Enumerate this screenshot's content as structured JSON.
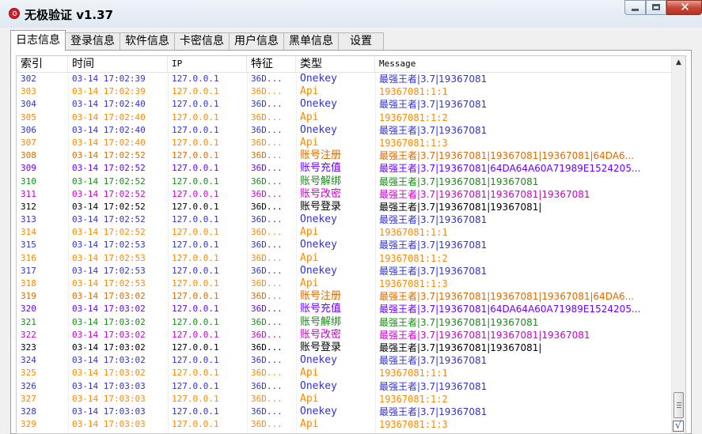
{
  "window": {
    "title": "无极验证 v1.37",
    "icon": "app-logo-icon",
    "buttons": {
      "minimize": "minimize-icon",
      "maximize": "maximize-icon",
      "close": "✕"
    }
  },
  "tabs": [
    {
      "label": "日志信息",
      "active": true
    },
    {
      "label": "登录信息"
    },
    {
      "label": "软件信息"
    },
    {
      "label": "卡密信息"
    },
    {
      "label": "用户信息"
    },
    {
      "label": "黑单信息"
    },
    {
      "label": "设置"
    }
  ],
  "colors": {
    "onekey": "#3333cc",
    "api": "#ff8800",
    "register": "#e06a00",
    "recharge": "#6a00ff",
    "unbind": "#1a8a1a",
    "modify": "#cc00cc",
    "login": "#000000"
  },
  "log_table": {
    "headers": [
      "索引",
      "时间",
      "IP",
      "特征",
      "类型",
      "Message"
    ],
    "rows": [
      {
        "idx": "302",
        "time": "03-14 17:02:39",
        "ip": "127.0.0.1",
        "feat": "36D...",
        "type": "Onekey",
        "msg": "最强王者|3.7|19367081",
        "kind": "onekey"
      },
      {
        "idx": "303",
        "time": "03-14 17:02:39",
        "ip": "127.0.0.1",
        "feat": "36D...",
        "type": "Api",
        "msg": "19367081:1:1",
        "kind": "api"
      },
      {
        "idx": "304",
        "time": "03-14 17:02:40",
        "ip": "127.0.0.1",
        "feat": "36D...",
        "type": "Onekey",
        "msg": "最强王者|3.7|19367081",
        "kind": "onekey"
      },
      {
        "idx": "305",
        "time": "03-14 17:02:40",
        "ip": "127.0.0.1",
        "feat": "36D...",
        "type": "Api",
        "msg": "19367081:1:2",
        "kind": "api"
      },
      {
        "idx": "306",
        "time": "03-14 17:02:40",
        "ip": "127.0.0.1",
        "feat": "36D...",
        "type": "Onekey",
        "msg": "最强王者|3.7|19367081",
        "kind": "onekey"
      },
      {
        "idx": "307",
        "time": "03-14 17:02:40",
        "ip": "127.0.0.1",
        "feat": "36D...",
        "type": "Api",
        "msg": "19367081:1:3",
        "kind": "api"
      },
      {
        "idx": "308",
        "time": "03-14 17:02:52",
        "ip": "127.0.0.1",
        "feat": "36D...",
        "type": "账号注册",
        "msg": "最强王者|3.7|19367081|19367081|19367081|64DA6...",
        "kind": "register"
      },
      {
        "idx": "309",
        "time": "03-14 17:02:52",
        "ip": "127.0.0.1",
        "feat": "36D...",
        "type": "账号充值",
        "msg": "最强王者|3.7|19367081|64DA64A60A71989E1524205...",
        "kind": "recharge"
      },
      {
        "idx": "310",
        "time": "03-14 17:02:52",
        "ip": "127.0.0.1",
        "feat": "36D...",
        "type": "账号解绑",
        "msg": "最强王者|3.7|19367081|19367081",
        "kind": "unbind"
      },
      {
        "idx": "311",
        "time": "03-14 17:02:52",
        "ip": "127.0.0.1",
        "feat": "36D...",
        "type": "账号改密",
        "msg": "最强王者|3.7|19367081|19367081|19367081",
        "kind": "modify"
      },
      {
        "idx": "312",
        "time": "03-14 17:02:52",
        "ip": "127.0.0.1",
        "feat": "36D...",
        "type": "账号登录",
        "msg": "最强王者|3.7|19367081|19367081|",
        "kind": "login"
      },
      {
        "idx": "313",
        "time": "03-14 17:02:52",
        "ip": "127.0.0.1",
        "feat": "36D...",
        "type": "Onekey",
        "msg": "最强王者|3.7|19367081",
        "kind": "onekey"
      },
      {
        "idx": "314",
        "time": "03-14 17:02:52",
        "ip": "127.0.0.1",
        "feat": "36D...",
        "type": "Api",
        "msg": "19367081:1:1",
        "kind": "api"
      },
      {
        "idx": "315",
        "time": "03-14 17:02:53",
        "ip": "127.0.0.1",
        "feat": "36D...",
        "type": "Onekey",
        "msg": "最强王者|3.7|19367081",
        "kind": "onekey"
      },
      {
        "idx": "316",
        "time": "03-14 17:02:53",
        "ip": "127.0.0.1",
        "feat": "36D...",
        "type": "Api",
        "msg": "19367081:1:2",
        "kind": "api"
      },
      {
        "idx": "317",
        "time": "03-14 17:02:53",
        "ip": "127.0.0.1",
        "feat": "36D...",
        "type": "Onekey",
        "msg": "最强王者|3.7|19367081",
        "kind": "onekey"
      },
      {
        "idx": "318",
        "time": "03-14 17:02:53",
        "ip": "127.0.0.1",
        "feat": "36D...",
        "type": "Api",
        "msg": "19367081:1:3",
        "kind": "api"
      },
      {
        "idx": "319",
        "time": "03-14 17:03:02",
        "ip": "127.0.0.1",
        "feat": "36D...",
        "type": "账号注册",
        "msg": "最强王者|3.7|19367081|19367081|19367081|64DA6...",
        "kind": "register"
      },
      {
        "idx": "320",
        "time": "03-14 17:03:02",
        "ip": "127.0.0.1",
        "feat": "36D...",
        "type": "账号充值",
        "msg": "最强王者|3.7|19367081|64DA64A60A71989E1524205...",
        "kind": "recharge"
      },
      {
        "idx": "321",
        "time": "03-14 17:03:02",
        "ip": "127.0.0.1",
        "feat": "36D...",
        "type": "账号解绑",
        "msg": "最强王者|3.7|19367081|19367081",
        "kind": "unbind"
      },
      {
        "idx": "322",
        "time": "03-14 17:03:02",
        "ip": "127.0.0.1",
        "feat": "36D...",
        "type": "账号改密",
        "msg": "最强王者|3.7|19367081|19367081|19367081",
        "kind": "modify"
      },
      {
        "idx": "323",
        "time": "03-14 17:03:02",
        "ip": "127.0.0.1",
        "feat": "36D...",
        "type": "账号登录",
        "msg": "最强王者|3.7|19367081|19367081|",
        "kind": "login"
      },
      {
        "idx": "324",
        "time": "03-14 17:03:02",
        "ip": "127.0.0.1",
        "feat": "36D...",
        "type": "Onekey",
        "msg": "最强王者|3.7|19367081",
        "kind": "onekey"
      },
      {
        "idx": "325",
        "time": "03-14 17:03:02",
        "ip": "127.0.0.1",
        "feat": "36D...",
        "type": "Api",
        "msg": "19367081:1:1",
        "kind": "api"
      },
      {
        "idx": "326",
        "time": "03-14 17:03:03",
        "ip": "127.0.0.1",
        "feat": "36D...",
        "type": "Onekey",
        "msg": "最强王者|3.7|19367081",
        "kind": "onekey"
      },
      {
        "idx": "327",
        "time": "03-14 17:03:03",
        "ip": "127.0.0.1",
        "feat": "36D...",
        "type": "Api",
        "msg": "19367081:1:2",
        "kind": "api"
      },
      {
        "idx": "328",
        "time": "03-14 17:03:03",
        "ip": "127.0.0.1",
        "feat": "36D...",
        "type": "Onekey",
        "msg": "最强王者|3.7|19367081",
        "kind": "onekey"
      },
      {
        "idx": "329",
        "time": "03-14 17:03:03",
        "ip": "127.0.0.1",
        "feat": "36D...",
        "type": "Api",
        "msg": "19367081:1:3",
        "kind": "api"
      }
    ]
  },
  "scrollbar": {
    "up_arrow": "▲",
    "auto_scroll_check": "√"
  }
}
